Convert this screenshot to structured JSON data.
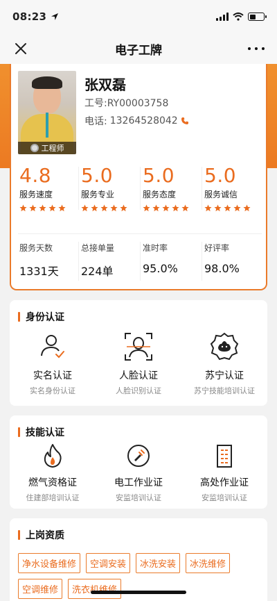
{
  "status": {
    "time": "08:23"
  },
  "nav": {
    "title": "电子工牌"
  },
  "profile": {
    "name": "张双磊",
    "id_label": "工号:",
    "id_value": "RY00003758",
    "phone_label": "电话:",
    "phone_value": "13264528042",
    "role": "工程师"
  },
  "ratings": [
    {
      "value": "4.8",
      "label": "服务速度",
      "stars": 5
    },
    {
      "value": "5.0",
      "label": "服务专业",
      "stars": 5
    },
    {
      "value": "5.0",
      "label": "服务态度",
      "stars": 5
    },
    {
      "value": "5.0",
      "label": "服务诚信",
      "stars": 5
    }
  ],
  "stats": [
    {
      "label": "服务天数",
      "value": "1331天"
    },
    {
      "label": "总接单量",
      "value": "224单"
    },
    {
      "label": "准时率",
      "value": "95.0%"
    },
    {
      "label": "好评率",
      "value": "98.0%"
    }
  ],
  "identity": {
    "title": "身份认证",
    "items": [
      {
        "name": "实名认证",
        "sub": "实名身份认证",
        "icon": "person-check-icon"
      },
      {
        "name": "人脸认证",
        "sub": "人脸识别认证",
        "icon": "face-scan-icon"
      },
      {
        "name": "苏宁认证",
        "sub": "苏宁技能培训认证",
        "icon": "suning-badge-icon"
      }
    ]
  },
  "skills": {
    "title": "技能认证",
    "items": [
      {
        "name": "燃气资格证",
        "sub": "住建部培训认证",
        "icon": "flame-icon"
      },
      {
        "name": "电工作业证",
        "sub": "安监培训认证",
        "icon": "plug-icon"
      },
      {
        "name": "高处作业证",
        "sub": "安监培训认证",
        "icon": "building-icon"
      }
    ]
  },
  "qualifications": {
    "title": "上岗资质",
    "tags": [
      "净水设备维修",
      "空调安装",
      "冰洗安装",
      "冰洗维修",
      "空调维修",
      "洗衣机维修"
    ]
  },
  "colors": {
    "accent": "#ea6c1f",
    "band": "#ec7a22"
  }
}
